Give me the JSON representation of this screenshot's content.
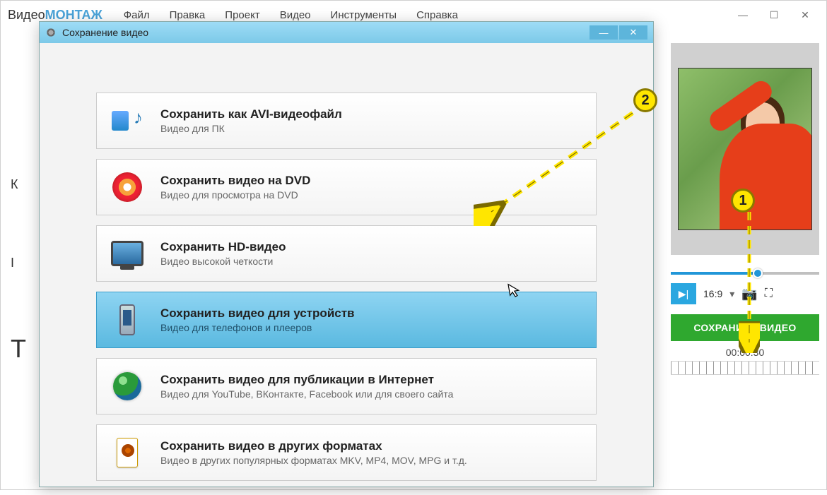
{
  "main": {
    "logo_a": "Видео",
    "logo_b": "МОНТАЖ",
    "menu": [
      "Файл",
      "Правка",
      "Проект",
      "Видео",
      "Инструменты",
      "Справка"
    ]
  },
  "preview": {
    "aspect": "16:9",
    "timecode": "00:00:30",
    "save_label": "СОХРАНИТЬ ВИДЕО"
  },
  "left_letters": {
    "k": "К",
    "i": "I",
    "t": "Т"
  },
  "dialog": {
    "title": "Сохранение видео",
    "options": [
      {
        "title": "Сохранить как AVI-видеофайл",
        "sub": "Видео для ПК"
      },
      {
        "title": "Сохранить видео на DVD",
        "sub": "Видео для просмотра на DVD"
      },
      {
        "title": "Сохранить HD-видео",
        "sub": "Видео высокой четкости"
      },
      {
        "title": "Сохранить видео для устройств",
        "sub": "Видео для телефонов и плееров"
      },
      {
        "title": "Сохранить видео для публикации в Интернет",
        "sub": "Видео для YouTube, ВКонтакте, Facebook или для своего сайта"
      },
      {
        "title": "Сохранить видео в других форматах",
        "sub": "Видео в других популярных форматах MKV, MP4, MOV, MPG и т.д."
      }
    ]
  },
  "badges": {
    "one": "1",
    "two": "2"
  }
}
